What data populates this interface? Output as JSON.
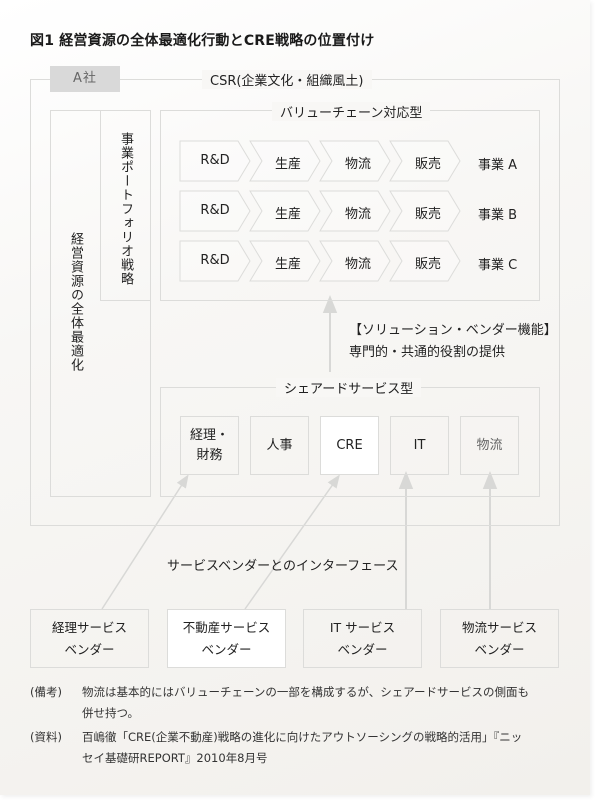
{
  "title": "図1 経営資源の全体最適化行動とCRE戦略の位置付け",
  "company_tag": "A社",
  "csr_label": "CSR(企業文化・組織風土)",
  "left_vertical_label": "経営資源の全体最適化",
  "portfolio_vertical_label": "事業ポートフォリオ戦略",
  "value_chain": {
    "label": "バリューチェーン対応型",
    "steps": [
      "R&D",
      "生産",
      "物流",
      "販売"
    ],
    "businesses": [
      "事業 A",
      "事業 B",
      "事業 C"
    ]
  },
  "solution_vendor": {
    "line1": "【ソリューション・ベンダー機能】",
    "line2": "専門的・共通的役割の提供"
  },
  "shared_services": {
    "label": "シェアードサービス型",
    "items": [
      {
        "label": "経理・\n財務",
        "highlight": false,
        "muted": false
      },
      {
        "label": "人事",
        "highlight": false,
        "muted": false
      },
      {
        "label": "CRE",
        "highlight": true,
        "muted": false
      },
      {
        "label": "IT",
        "highlight": false,
        "muted": false
      },
      {
        "label": "物流",
        "highlight": false,
        "muted": true
      }
    ]
  },
  "interface_label": "サービスベンダーとのインターフェース",
  "vendors": [
    {
      "label": "経理サービス\nベンダー",
      "highlight": false
    },
    {
      "label": "不動産サービス\nベンダー",
      "highlight": true
    },
    {
      "label": "IT サービス\nベンダー",
      "highlight": false
    },
    {
      "label": "物流サービス\nベンダー",
      "highlight": false
    }
  ],
  "notes": [
    {
      "key": "(備考)",
      "lines": [
        "物流は基本的にはバリューチェーンの一部を構成するが、シェアードサービスの側面も",
        "併せ持つ。"
      ]
    },
    {
      "key": "(資料)",
      "lines": [
        "百嶋徹「CRE(企業不動産)戦略の進化に向けたアウトソーシングの戦略的活用」『ニッ",
        "セイ基礎研REPORT』2010年8月号"
      ]
    }
  ],
  "colors": {
    "border": "#dcdcda",
    "arrow": "#d8d8d6",
    "tag_bg": "#d9d9d9",
    "highlight_bg": "#ffffff"
  }
}
